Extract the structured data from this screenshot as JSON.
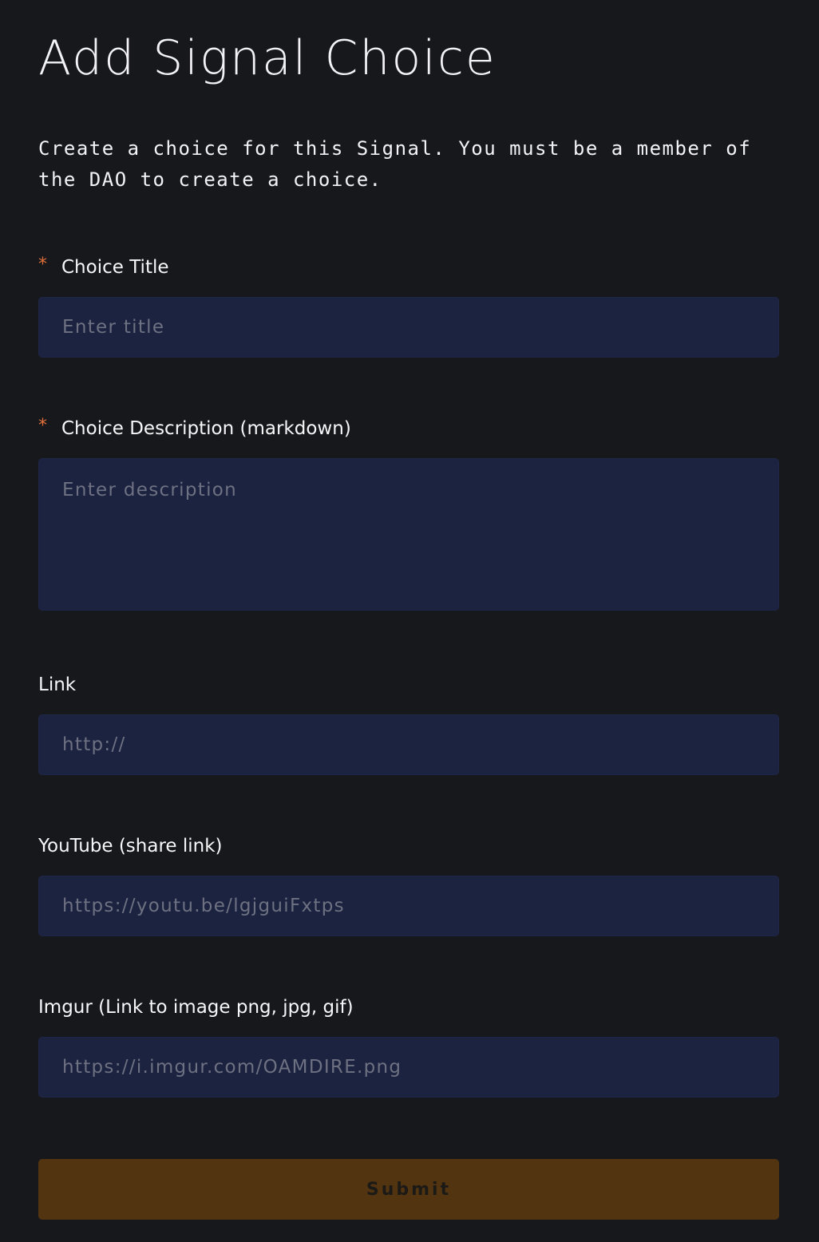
{
  "page": {
    "title": "Add Signal Choice",
    "intro": "Create a choice for this Signal. You must be a member of the DAO to create a choice."
  },
  "form": {
    "required_mark": "*",
    "fields": {
      "title": {
        "label": "Choice Title",
        "placeholder": "Enter title",
        "value": "",
        "required": true
      },
      "description": {
        "label": "Choice Description (markdown)",
        "placeholder": "Enter description",
        "value": "",
        "required": true
      },
      "link": {
        "label": "Link",
        "placeholder": "http://",
        "value": "",
        "required": false
      },
      "youtube": {
        "label": "YouTube (share link)",
        "placeholder": "https://youtu.be/lgjguiFxtps",
        "value": "",
        "required": false
      },
      "imgur": {
        "label": "Imgur (Link to image png, jpg, gif)",
        "placeholder": "https://i.imgur.com/OAMDIRE.png",
        "value": "",
        "required": false
      }
    },
    "submit_label": "Submit"
  },
  "colors": {
    "background": "#17181b",
    "input_background": "#1c2340",
    "required_mark": "#e0703a",
    "submit_background": "#533410"
  }
}
